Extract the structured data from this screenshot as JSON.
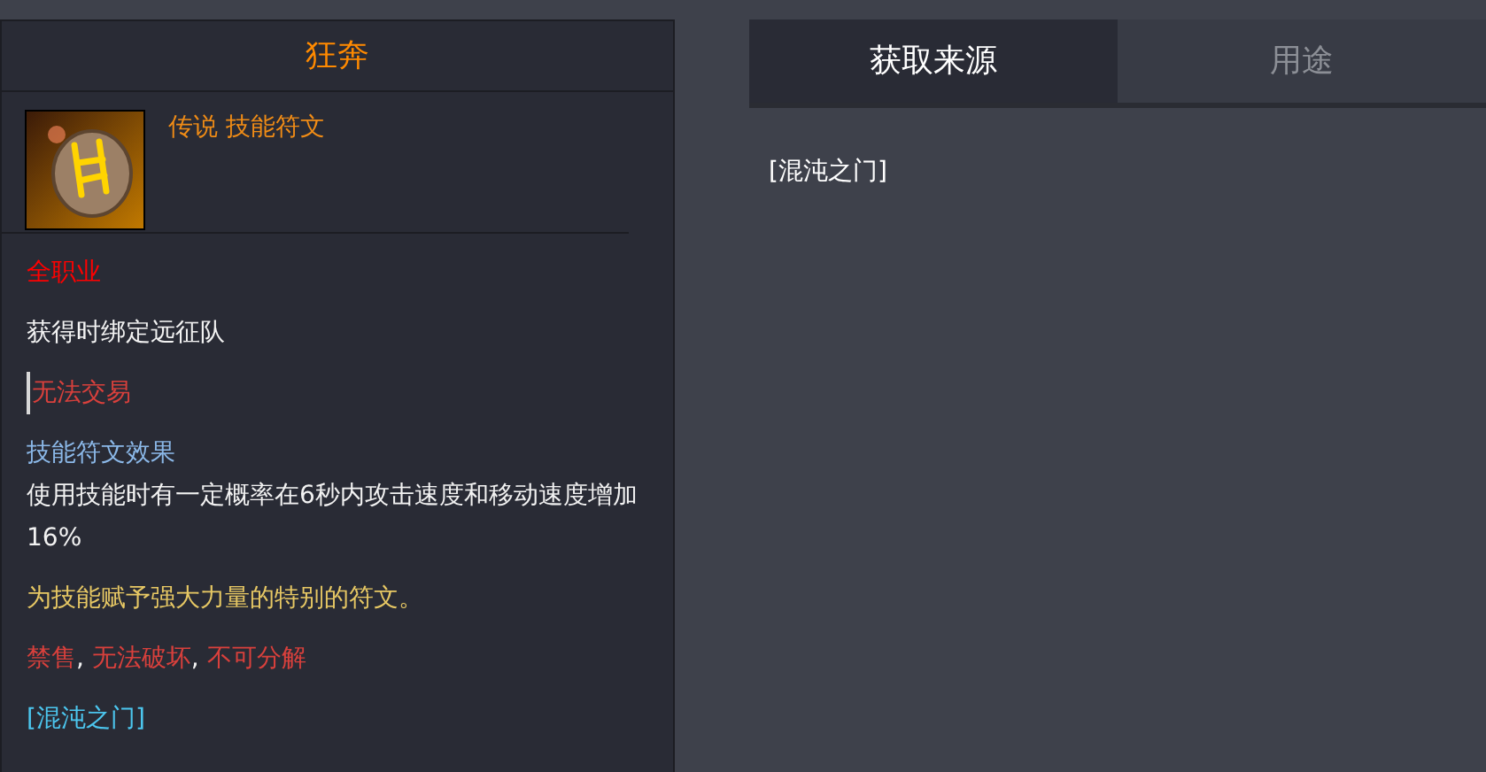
{
  "tooltip": {
    "title": "狂奔",
    "item_type": "传说 技能符文",
    "lines": [
      {
        "kind": "class",
        "segments": [
          {
            "text": "全职业",
            "kind": "class"
          }
        ]
      },
      {
        "kind": "plain",
        "segments": [
          {
            "text": "获得时绑定远征队",
            "kind": "plain"
          }
        ]
      },
      {
        "kind": "trade",
        "segments": [
          {
            "text": "无法交易",
            "kind": "warn"
          }
        ]
      },
      {
        "kind": "effect",
        "segments": [
          {
            "text": "技能符文效果",
            "kind": "heading"
          }
        ]
      },
      {
        "kind": "plain",
        "segments": [
          {
            "text": "使用技能时有一定概率在6秒内攻击速度和移动速度增加16%",
            "kind": "plain"
          }
        ]
      },
      {
        "kind": "plain",
        "segments": [
          {
            "text": "为技能赋予强大力量的特别的符文。",
            "kind": "lore"
          }
        ]
      },
      {
        "kind": "plain",
        "segments": [
          {
            "text": "禁售",
            "kind": "warn",
            "separator": ", "
          },
          {
            "text": "无法破坏",
            "kind": "warn",
            "separator": ", "
          },
          {
            "text": "不可分解",
            "kind": "warn"
          }
        ]
      },
      {
        "kind": "plain",
        "segments": [
          {
            "text": "[混沌之门]",
            "kind": "source"
          }
        ]
      }
    ]
  },
  "tabs": [
    {
      "label": "获取来源",
      "selected": true
    },
    {
      "label": "用途",
      "selected": false
    }
  ],
  "sources": [
    "[混沌之门]"
  ]
}
